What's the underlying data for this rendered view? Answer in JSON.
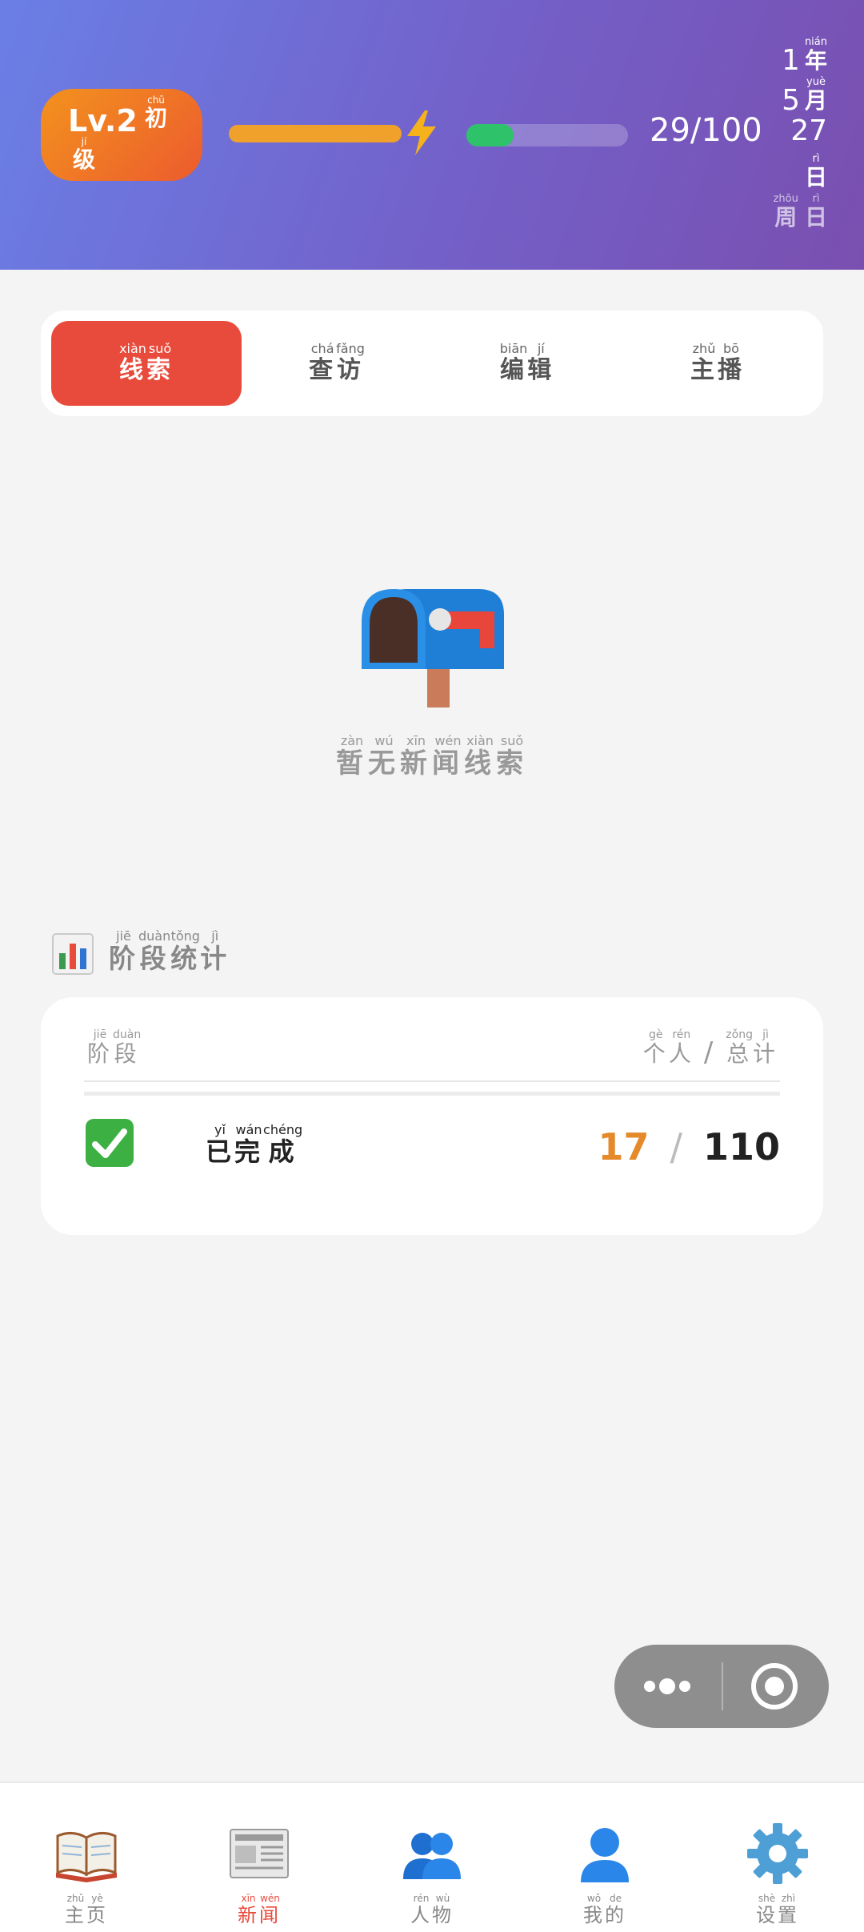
{
  "header": {
    "level": {
      "num": "Lv.2",
      "word1": {
        "char": "初",
        "py": "chū"
      },
      "word2": {
        "char": "级",
        "py": "jí"
      }
    },
    "energy": {
      "text": "29/100",
      "fraction": 0.29
    },
    "date": {
      "year": {
        "num": "1",
        "char": "年",
        "py": "nián"
      },
      "month": {
        "num": "5",
        "char": "月",
        "py": "yuè"
      },
      "day": {
        "num": "27",
        "char": "日",
        "py": "rì"
      },
      "week": [
        {
          "char": "周",
          "py": "zhōu"
        },
        {
          "char": "日",
          "py": "rì"
        }
      ]
    },
    "colors": {
      "xp_bar": "#f0a12b",
      "energy_fill": "#2ec26a",
      "level_badge": "#ec6a26"
    }
  },
  "tabs": [
    {
      "chars": [
        {
          "char": "线",
          "py": "xiàn"
        },
        {
          "char": "索",
          "py": "suǒ"
        }
      ],
      "active": true
    },
    {
      "chars": [
        {
          "char": "查",
          "py": "chá"
        },
        {
          "char": "访",
          "py": "fǎng"
        }
      ],
      "active": false
    },
    {
      "chars": [
        {
          "char": "编",
          "py": "biān"
        },
        {
          "char": "辑",
          "py": "jí"
        }
      ],
      "active": false
    },
    {
      "chars": [
        {
          "char": "主",
          "py": "zhǔ"
        },
        {
          "char": "播",
          "py": "bō"
        }
      ],
      "active": false
    }
  ],
  "empty": {
    "icon": "mailbox-icon",
    "chars": [
      {
        "char": "暂",
        "py": "zàn"
      },
      {
        "char": "无",
        "py": "wú"
      },
      {
        "char": "新",
        "py": "xīn"
      },
      {
        "char": "闻",
        "py": "wén"
      },
      {
        "char": "线",
        "py": "xiàn"
      },
      {
        "char": "索",
        "py": "suǒ"
      }
    ]
  },
  "stats": {
    "title": [
      {
        "char": "阶",
        "py": "jiē"
      },
      {
        "char": "段",
        "py": "duàn"
      },
      {
        "char": "统",
        "py": "tǒng"
      },
      {
        "char": "计",
        "py": "jì"
      }
    ],
    "head_left": [
      {
        "char": "阶",
        "py": "jiē"
      },
      {
        "char": "段",
        "py": "duàn"
      }
    ],
    "head_right_a": [
      {
        "char": "个",
        "py": "gè"
      },
      {
        "char": "人",
        "py": "rén"
      }
    ],
    "head_slash": "/",
    "head_right_b": [
      {
        "char": "总",
        "py": "zǒng"
      },
      {
        "char": "计",
        "py": "jì"
      }
    ],
    "rows": [
      {
        "icon": "check-icon",
        "label": [
          {
            "char": "已",
            "py": "yǐ"
          },
          {
            "char": "完",
            "py": "wán"
          },
          {
            "char": "成",
            "py": "chéng"
          }
        ],
        "personal": "17",
        "slash": "/",
        "total": "110"
      }
    ]
  },
  "nav": [
    {
      "icon": "book-icon",
      "chars": [
        {
          "char": "主",
          "py": "zhǔ"
        },
        {
          "char": "页",
          "py": "yè"
        }
      ],
      "active": false
    },
    {
      "icon": "newspaper-icon",
      "chars": [
        {
          "char": "新",
          "py": "xīn"
        },
        {
          "char": "闻",
          "py": "wén"
        }
      ],
      "active": true
    },
    {
      "icon": "people-icon",
      "chars": [
        {
          "char": "人",
          "py": "rén"
        },
        {
          "char": "物",
          "py": "wù"
        }
      ],
      "active": false
    },
    {
      "icon": "person-icon",
      "chars": [
        {
          "char": "我",
          "py": "wǒ"
        },
        {
          "char": "的",
          "py": "de"
        }
      ],
      "active": false
    },
    {
      "icon": "gear-icon",
      "chars": [
        {
          "char": "设",
          "py": "shè"
        },
        {
          "char": "置",
          "py": "zhì"
        }
      ],
      "active": false
    }
  ]
}
